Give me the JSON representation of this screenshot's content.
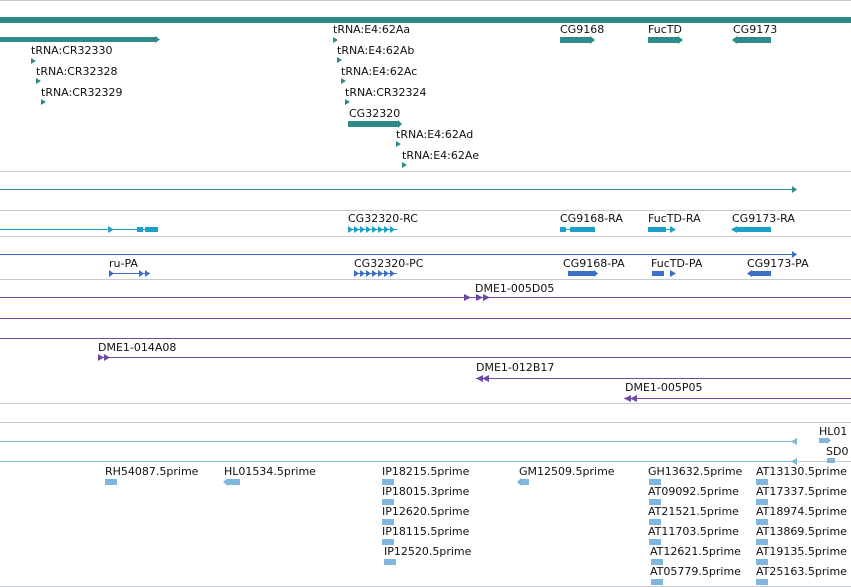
{
  "colors": {
    "gene": "#2f8a8a",
    "transcript_rc": "#1ba0c8",
    "protein_pa": "#3b6fc8",
    "clone": "#6e4aa6",
    "est": "#7fb6dc",
    "divider": "#c7ccd4"
  },
  "genes": [
    {
      "label": "tRNA:CR32330"
    },
    {
      "label": "tRNA:CR32328"
    },
    {
      "label": "tRNA:CR32329"
    },
    {
      "label": "tRNA:E4:62Aa"
    },
    {
      "label": "tRNA:E4:62Ab"
    },
    {
      "label": "tRNA:E4:62Ac"
    },
    {
      "label": "tRNA:CR32324"
    },
    {
      "label": "CG32320"
    },
    {
      "label": "tRNA:E4:62Ad"
    },
    {
      "label": "tRNA:E4:62Ae"
    },
    {
      "label": "CG9168"
    },
    {
      "label": "FucTD"
    },
    {
      "label": "CG9173"
    }
  ],
  "transcripts": [
    {
      "label": "CG32320-RC"
    },
    {
      "label": "CG9168-RA"
    },
    {
      "label": "FucTD-RA"
    },
    {
      "label": "CG9173-RA"
    }
  ],
  "proteins": [
    {
      "label": "ru-PA"
    },
    {
      "label": "CG32320-PC"
    },
    {
      "label": "CG9168-PA"
    },
    {
      "label": "FucTD-PA"
    },
    {
      "label": "CG9173-PA"
    }
  ],
  "clones": [
    {
      "label": "DME1-005D05"
    },
    {
      "label": "DME1-014A08"
    },
    {
      "label": "DME1-012B17"
    },
    {
      "label": "DME1-005P05"
    }
  ],
  "ests": [
    {
      "label": "HL01"
    },
    {
      "label": "SD0"
    },
    {
      "label": "RH54087.5prime"
    },
    {
      "label": "HL01534.5prime"
    },
    {
      "label": "IP18215.5prime"
    },
    {
      "label": "IP18015.3prime"
    },
    {
      "label": "IP12620.5prime"
    },
    {
      "label": "IP18115.5prime"
    },
    {
      "label": "IP12520.5prime"
    },
    {
      "label": "GM12509.5prime"
    },
    {
      "label": "GH13632.5prime"
    },
    {
      "label": "AT09092.5prime"
    },
    {
      "label": "AT21521.5prime"
    },
    {
      "label": "AT11703.5prime"
    },
    {
      "label": "AT12621.5prime"
    },
    {
      "label": "AT05779.5prime"
    },
    {
      "label": "AT13130.5prime"
    },
    {
      "label": "AT17337.5prime"
    },
    {
      "label": "AT18974.5prime"
    },
    {
      "label": "AT13869.5prime"
    },
    {
      "label": "AT19135.5prime"
    },
    {
      "label": "AT25163.5prime"
    }
  ]
}
